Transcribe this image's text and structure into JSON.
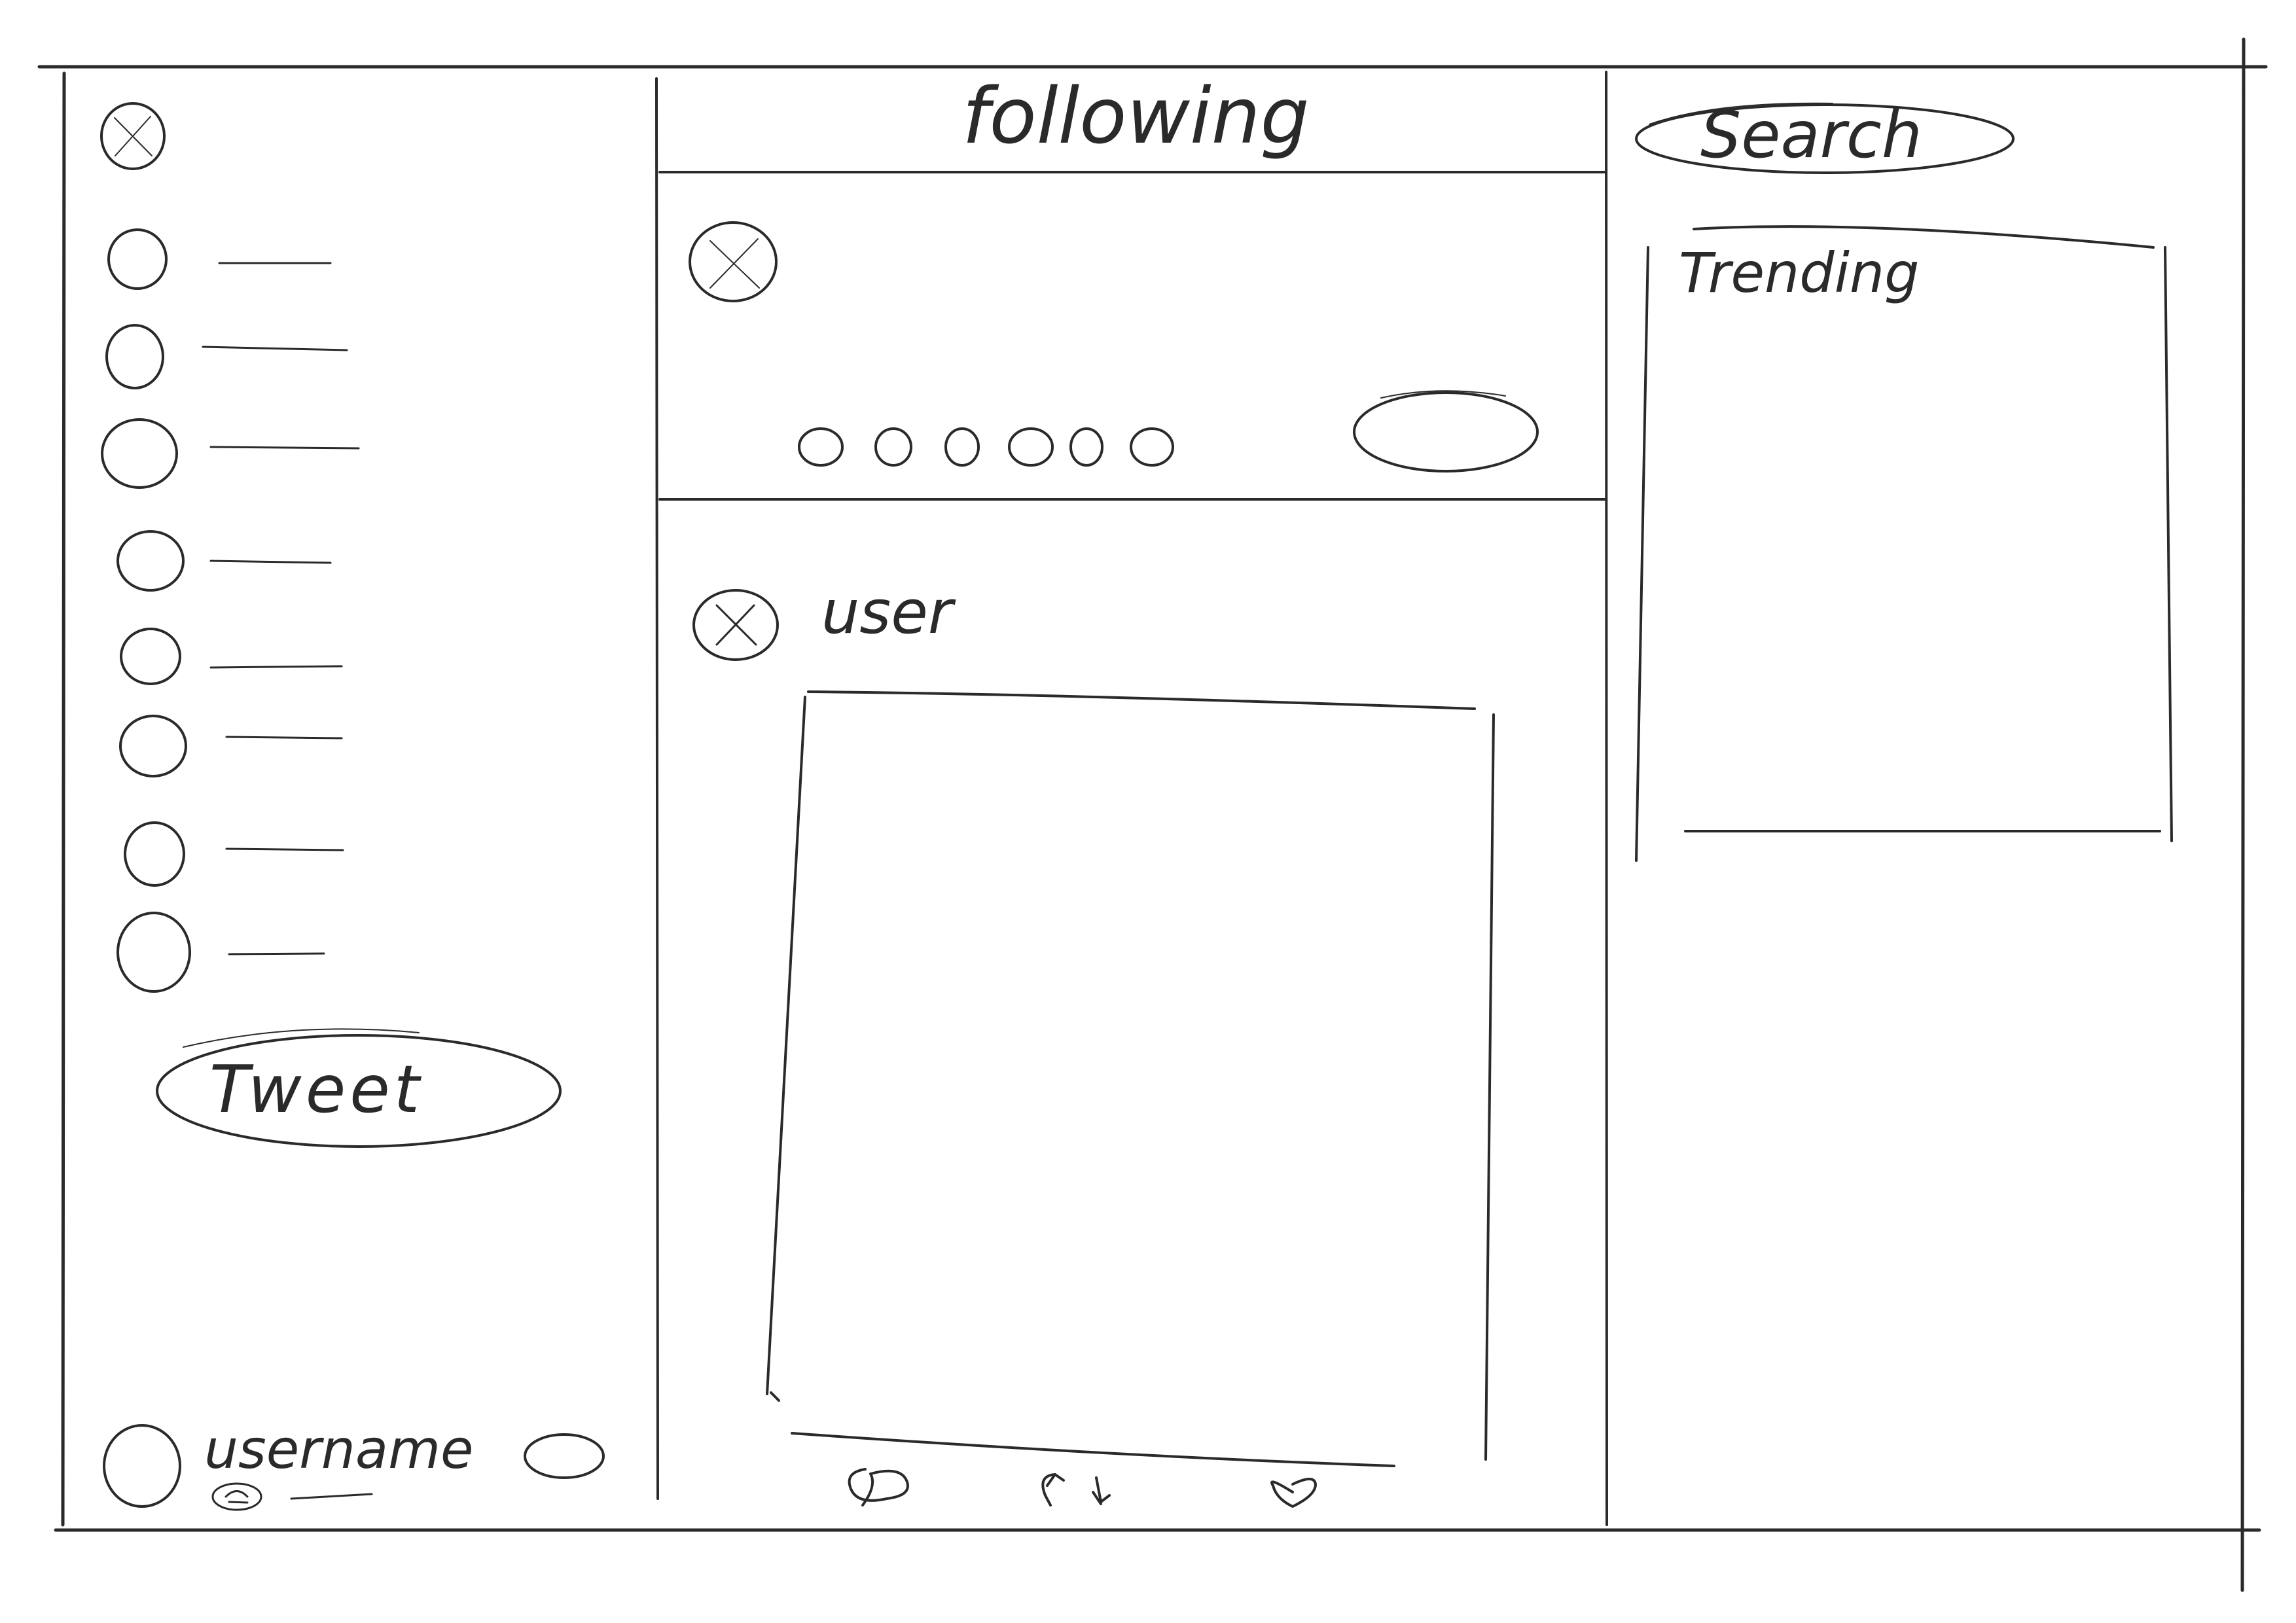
{
  "header": {
    "feed_title": "following"
  },
  "search": {
    "placeholder": "Search"
  },
  "trending": {
    "title": "Trending"
  },
  "sidebar": {
    "tweet_button_label": "Tweet",
    "account": {
      "username": "username"
    },
    "nav_items": [
      {
        "icon": "nav-icon"
      },
      {
        "icon": "nav-icon"
      },
      {
        "icon": "nav-icon"
      },
      {
        "icon": "nav-icon"
      },
      {
        "icon": "nav-icon"
      },
      {
        "icon": "nav-icon"
      },
      {
        "icon": "nav-icon"
      },
      {
        "icon": "nav-icon"
      }
    ]
  },
  "post": {
    "author": "user"
  },
  "composer": {
    "tool_icon_count": 6
  },
  "colors": {
    "ink": "#2a2a2a",
    "paper": "#ffffff"
  }
}
